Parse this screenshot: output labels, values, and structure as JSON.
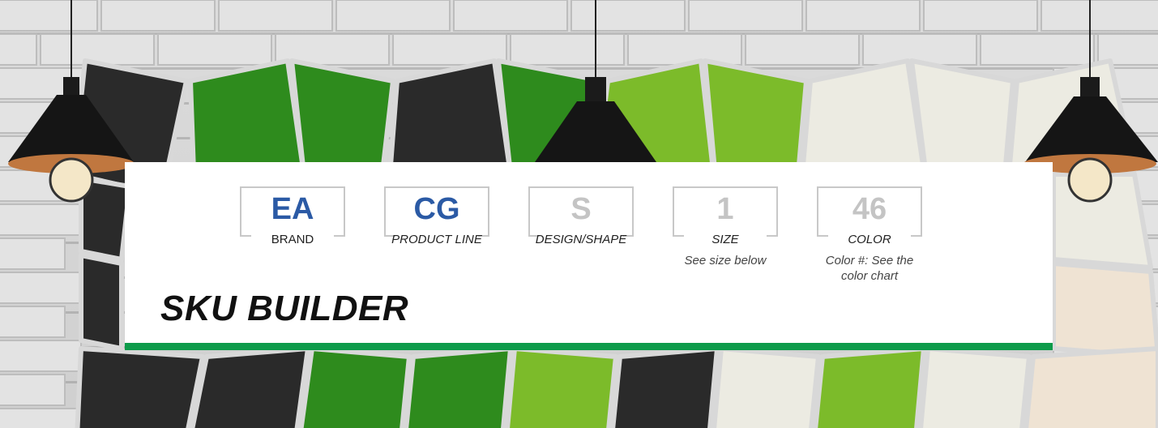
{
  "sku_builder": {
    "title": "SKU BUILDER",
    "segments": [
      {
        "code": "EA",
        "label": "BRAND",
        "note": ""
      },
      {
        "code": "CG",
        "label": "PRODUCT LINE",
        "note": ""
      },
      {
        "code": "S",
        "label": "DESIGN/SHAPE",
        "note": ""
      },
      {
        "code": "1",
        "label": "SIZE",
        "note": "See size below"
      },
      {
        "code": "46",
        "label": "COLOR",
        "note": "Color #: See the color chart"
      }
    ]
  },
  "colors": {
    "accent_green": "#0d9b4a",
    "code_blue": "#2b5aa5",
    "code_gray": "#c4c4c4"
  }
}
